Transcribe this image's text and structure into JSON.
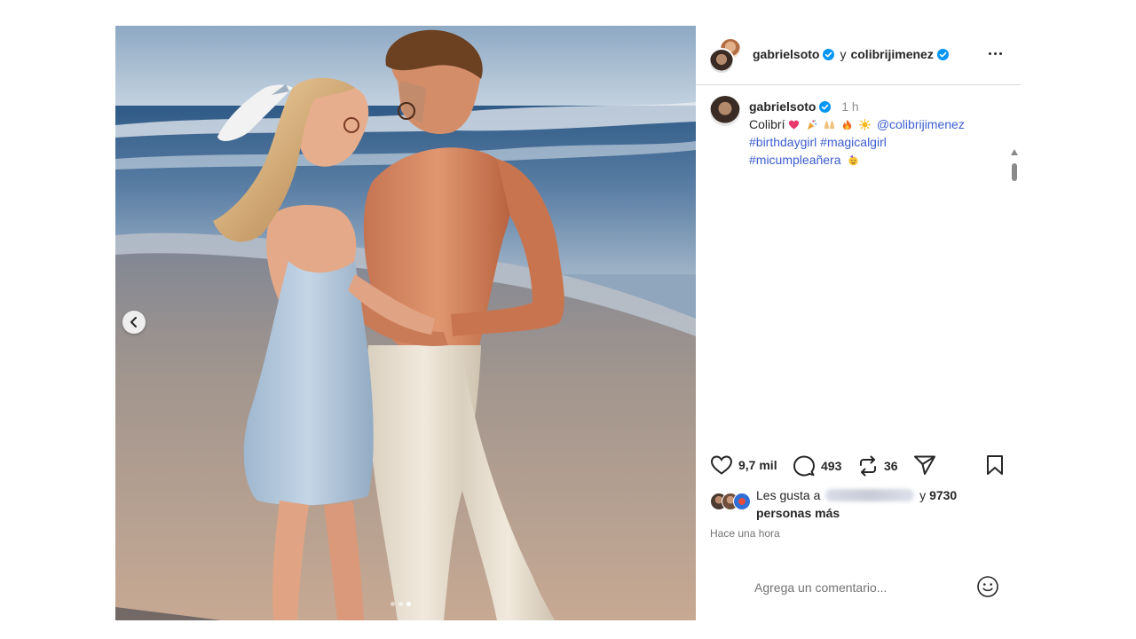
{
  "post": {
    "author": "gabrielsoto",
    "conjunction": "y",
    "collaborator": "colibrijimenez",
    "carousel": {
      "current": 3,
      "total": 3
    }
  },
  "caption": {
    "username": "gabrielsoto",
    "time": "1 h",
    "text_start": "Colibrí",
    "emojis": [
      "heart-emoji",
      "party-popper-emoji",
      "raising-hands-emoji",
      "fire-emoji",
      "sun-emoji"
    ],
    "mention": "@colibrijimenez",
    "hashtag_1": "#birthdaygirl",
    "hashtag_2": "#magicalgirl",
    "hashtag_3": "#micumpleañera",
    "trailing_emoji": "partying-face-emoji"
  },
  "actions": {
    "likes": "9,7 mil",
    "comments": "493",
    "reposts": "36"
  },
  "liked_by": {
    "prefix": "Les gusta a",
    "connector": "y",
    "count": "9730",
    "suffix": "personas más"
  },
  "timestamp": "Hace una hora",
  "comment": {
    "placeholder": "Agrega un comentario..."
  },
  "colors": {
    "link": "#3b5dd1",
    "verified": "#0095f6",
    "heart": "#ed4956"
  }
}
